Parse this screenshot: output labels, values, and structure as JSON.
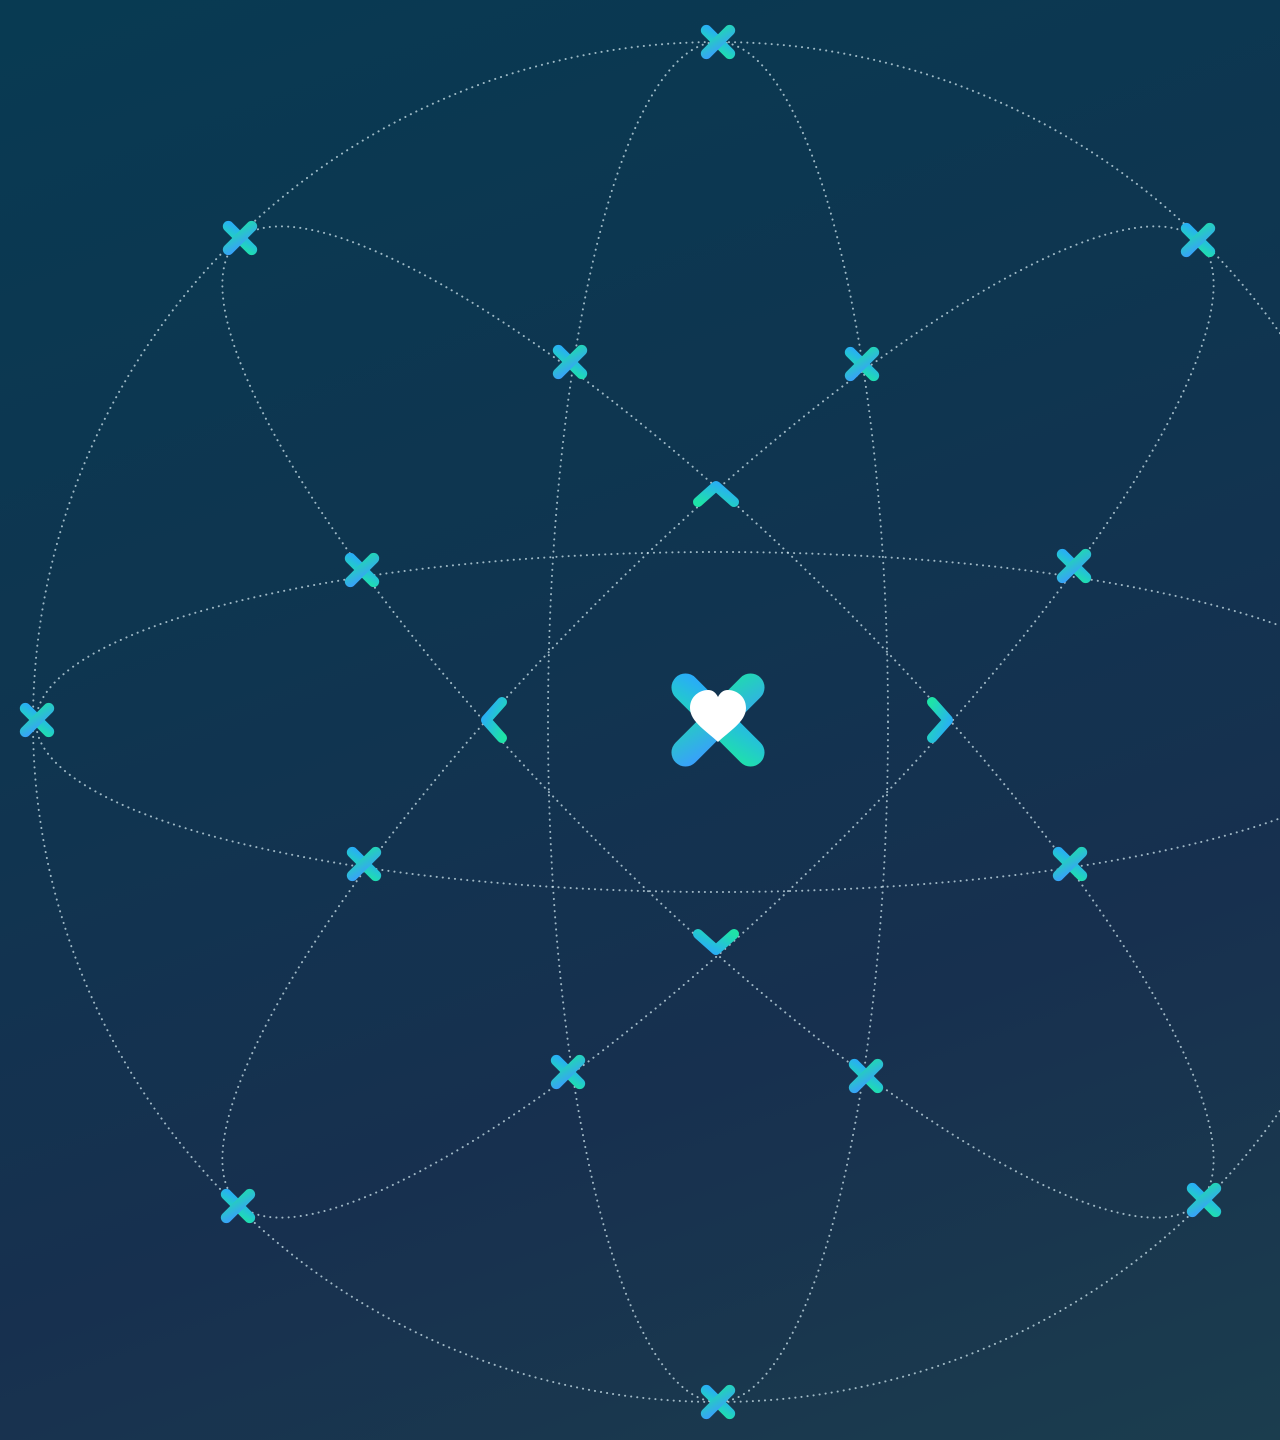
{
  "scene": {
    "background": "#0f3550",
    "orbit_color": "#cfe6ee",
    "accent_gradient": [
      "#1ee3a8",
      "#2aa7ff"
    ],
    "center_logo": {
      "icon": "heart-cross-logo",
      "heart_color": "#ffffff"
    },
    "orbit_count": 4,
    "marker_icon": "cross-icon",
    "chevron_icons": [
      "chevron-up-icon",
      "chevron-right-icon",
      "chevron-down-icon",
      "chevron-left-icon"
    ]
  }
}
